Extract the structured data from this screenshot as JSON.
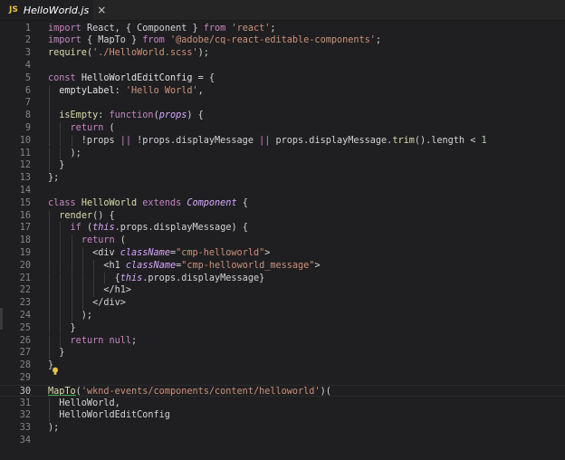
{
  "tab": {
    "badge": "JS",
    "filename": "HelloWorld.js",
    "close": "×"
  },
  "lines": [
    {
      "n": "1",
      "indent": 0,
      "tokens": [
        [
          "kw",
          "import"
        ],
        [
          "punc",
          " React, { Component } "
        ],
        [
          "kw",
          "from"
        ],
        [
          "punc",
          " "
        ],
        [
          "str",
          "'react'"
        ],
        [
          "punc",
          ";"
        ]
      ]
    },
    {
      "n": "2",
      "indent": 0,
      "tokens": [
        [
          "kw",
          "import"
        ],
        [
          "punc",
          " { MapTo } "
        ],
        [
          "kw",
          "from"
        ],
        [
          "punc",
          " "
        ],
        [
          "str",
          "'@adobe/cq-react-editable-components'"
        ],
        [
          "punc",
          ";"
        ]
      ]
    },
    {
      "n": "3",
      "indent": 0,
      "tokens": [
        [
          "fn",
          "require"
        ],
        [
          "punc",
          "("
        ],
        [
          "str",
          "'./HelloWorld.scss'"
        ],
        [
          "punc",
          ");"
        ]
      ]
    },
    {
      "n": "4",
      "indent": 0,
      "tokens": []
    },
    {
      "n": "5",
      "indent": 0,
      "tokens": [
        [
          "kw",
          "const"
        ],
        [
          "punc",
          " "
        ],
        [
          "var",
          "HelloWorldEditConfig"
        ],
        [
          "punc",
          " = {"
        ]
      ]
    },
    {
      "n": "6",
      "indent": 1,
      "tokens": [
        [
          "punc",
          "  "
        ],
        [
          "prop",
          "emptyLabel"
        ],
        [
          "punc",
          ": "
        ],
        [
          "str",
          "'Hello World'"
        ],
        [
          "punc",
          ","
        ]
      ]
    },
    {
      "n": "7",
      "indent": 1,
      "tokens": []
    },
    {
      "n": "8",
      "indent": 1,
      "tokens": [
        [
          "punc",
          "  "
        ],
        [
          "fn",
          "isEmpty"
        ],
        [
          "punc",
          ": "
        ],
        [
          "kw",
          "function"
        ],
        [
          "punc",
          "("
        ],
        [
          "italic",
          "props"
        ],
        [
          "punc",
          ") {"
        ]
      ]
    },
    {
      "n": "9",
      "indent": 2,
      "tokens": [
        [
          "punc",
          "    "
        ],
        [
          "kw",
          "return"
        ],
        [
          "punc",
          " ("
        ]
      ]
    },
    {
      "n": "10",
      "indent": 3,
      "tokens": [
        [
          "punc",
          "      !props "
        ],
        [
          "kw",
          "||"
        ],
        [
          "punc",
          " !props.displayMessage "
        ],
        [
          "kw",
          "||"
        ],
        [
          "punc",
          " props.displayMessage."
        ],
        [
          "fn",
          "trim"
        ],
        [
          "punc",
          "().length < "
        ],
        [
          "num",
          "1"
        ]
      ]
    },
    {
      "n": "11",
      "indent": 2,
      "tokens": [
        [
          "punc",
          "    );"
        ]
      ]
    },
    {
      "n": "12",
      "indent": 1,
      "tokens": [
        [
          "punc",
          "  }"
        ]
      ]
    },
    {
      "n": "13",
      "indent": 0,
      "tokens": [
        [
          "punc",
          "};"
        ]
      ]
    },
    {
      "n": "14",
      "indent": 0,
      "tokens": []
    },
    {
      "n": "15",
      "indent": 0,
      "tokens": [
        [
          "kw",
          "class"
        ],
        [
          "punc",
          " "
        ],
        [
          "cls",
          "HelloWorld"
        ],
        [
          "punc",
          " "
        ],
        [
          "kw",
          "extends"
        ],
        [
          "punc",
          " "
        ],
        [
          "italic",
          "Component"
        ],
        [
          "punc",
          " {"
        ]
      ]
    },
    {
      "n": "16",
      "indent": 1,
      "tokens": [
        [
          "punc",
          "  "
        ],
        [
          "fn",
          "render"
        ],
        [
          "punc",
          "() {"
        ]
      ]
    },
    {
      "n": "17",
      "indent": 2,
      "tokens": [
        [
          "punc",
          "    "
        ],
        [
          "kw",
          "if"
        ],
        [
          "punc",
          " ("
        ],
        [
          "italic",
          "this"
        ],
        [
          "punc",
          ".props.displayMessage) {"
        ]
      ]
    },
    {
      "n": "18",
      "indent": 3,
      "tokens": [
        [
          "punc",
          "      "
        ],
        [
          "kw",
          "return"
        ],
        [
          "punc",
          " ("
        ]
      ]
    },
    {
      "n": "19",
      "indent": 4,
      "tokens": [
        [
          "punc",
          "        <"
        ],
        [
          "tag",
          "div"
        ],
        [
          "punc",
          " "
        ],
        [
          "attr",
          "className"
        ],
        [
          "punc",
          "="
        ],
        [
          "str",
          "\"cmp-helloworld\""
        ],
        [
          "punc",
          ">"
        ]
      ]
    },
    {
      "n": "20",
      "indent": 5,
      "tokens": [
        [
          "punc",
          "          <"
        ],
        [
          "tag",
          "h1"
        ],
        [
          "punc",
          " "
        ],
        [
          "attr",
          "className"
        ],
        [
          "punc",
          "="
        ],
        [
          "str",
          "\"cmp-helloworld_message\""
        ],
        [
          "punc",
          ">"
        ]
      ]
    },
    {
      "n": "21",
      "indent": 6,
      "tokens": [
        [
          "punc",
          "            {"
        ],
        [
          "italic",
          "this"
        ],
        [
          "punc",
          ".props.displayMessage}"
        ]
      ]
    },
    {
      "n": "22",
      "indent": 5,
      "tokens": [
        [
          "punc",
          "          </"
        ],
        [
          "tag",
          "h1"
        ],
        [
          "punc",
          ">"
        ]
      ]
    },
    {
      "n": "23",
      "indent": 4,
      "tokens": [
        [
          "punc",
          "        </"
        ],
        [
          "tag",
          "div"
        ],
        [
          "punc",
          ">"
        ]
      ]
    },
    {
      "n": "24",
      "indent": 3,
      "tokens": [
        [
          "punc",
          "      );"
        ]
      ]
    },
    {
      "n": "25",
      "indent": 2,
      "tokens": [
        [
          "punc",
          "    }"
        ]
      ]
    },
    {
      "n": "26",
      "indent": 2,
      "tokens": [
        [
          "punc",
          "    "
        ],
        [
          "kw",
          "return"
        ],
        [
          "punc",
          " "
        ],
        [
          "kw",
          "null"
        ],
        [
          "punc",
          ";"
        ]
      ]
    },
    {
      "n": "27",
      "indent": 1,
      "tokens": [
        [
          "punc",
          "  }"
        ]
      ]
    },
    {
      "n": "28",
      "indent": 0,
      "tokens": [
        [
          "punc",
          "}"
        ]
      ]
    },
    {
      "n": "29",
      "indent": 0,
      "tokens": []
    },
    {
      "n": "30",
      "indent": 0,
      "current": true,
      "tokens": [
        [
          "mapto",
          "MapTo"
        ],
        [
          "punc",
          "("
        ],
        [
          "str",
          "'wknd-events/components/content/helloworld'"
        ],
        [
          "punc",
          ")("
        ]
      ]
    },
    {
      "n": "31",
      "indent": 1,
      "tokens": [
        [
          "punc",
          "  HelloWorld,"
        ]
      ]
    },
    {
      "n": "32",
      "indent": 1,
      "tokens": [
        [
          "punc",
          "  HelloWorldEditConfig"
        ]
      ]
    },
    {
      "n": "33",
      "indent": 0,
      "tokens": [
        [
          "punc",
          ");"
        ]
      ]
    },
    {
      "n": "34",
      "indent": 0,
      "tokens": []
    }
  ]
}
